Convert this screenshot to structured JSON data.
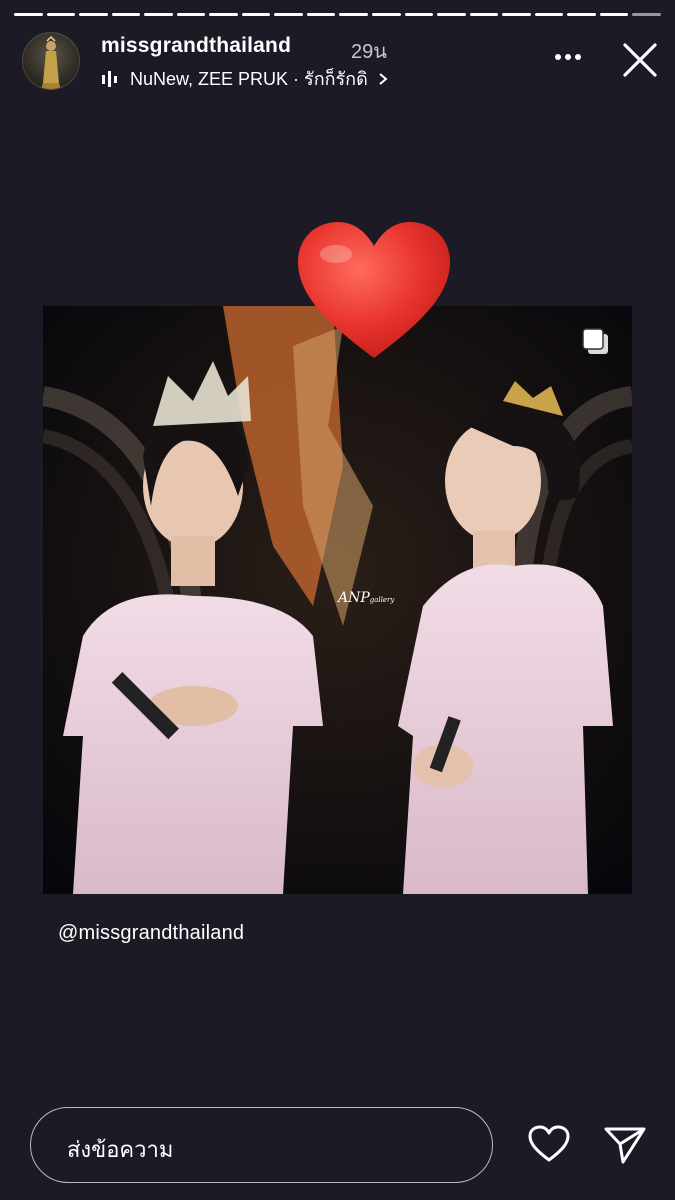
{
  "story": {
    "segments_total": 20,
    "segments_completed": 19
  },
  "header": {
    "username": "missgrandthailand",
    "time_ago": "29น",
    "music_text": "NuNew, ZEE PRUK · รักก็รักดิ",
    "avatar_icon": "profile-avatar",
    "more_icon": "more-horizontal-icon",
    "close_icon": "close-icon"
  },
  "content": {
    "photo_alt": "two women in pink sequin gowns wearing crowns holding microphones",
    "watermark": "ANP",
    "watermark_sub": "gallery",
    "sticker": "heart-sticker",
    "multi_icon": "carousel-icon",
    "mention": "@missgrandthailand"
  },
  "footer": {
    "reply_placeholder": "ส่งข้อความ",
    "like_icon": "heart-outline-icon",
    "send_icon": "send-icon"
  },
  "colors": {
    "background": "#1c1b25",
    "heart": "#e8322c"
  }
}
